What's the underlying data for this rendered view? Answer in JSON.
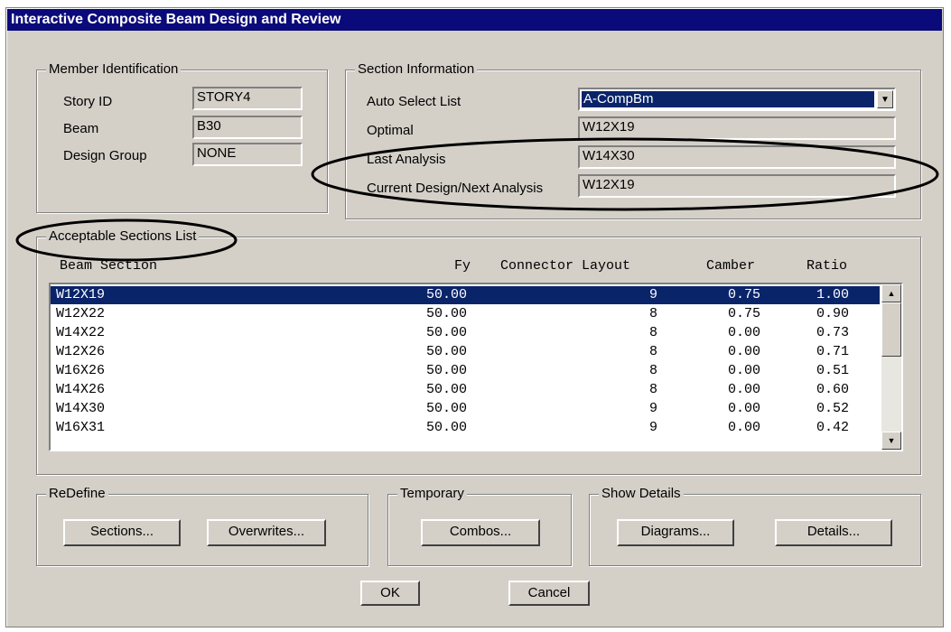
{
  "window": {
    "title": "Interactive Composite Beam Design and Review"
  },
  "member_identification": {
    "title": "Member Identification",
    "story_label": "Story ID",
    "story_value": "STORY4",
    "beam_label": "Beam",
    "beam_value": "B30",
    "group_label": "Design Group",
    "group_value": "NONE"
  },
  "section_information": {
    "title": "Section Information",
    "auto_select_label": "Auto Select List",
    "auto_select_value": "A-CompBm",
    "optimal_label": "Optimal",
    "optimal_value": "W12X19",
    "last_analysis_label": "Last Analysis",
    "last_analysis_value": "W14X30",
    "current_label": "Current Design/Next Analysis",
    "current_value": "W12X19"
  },
  "acceptable_sections": {
    "title": "Acceptable Sections List",
    "columns": [
      "Beam Section",
      "Fy",
      "Connector Layout",
      "Camber",
      "Ratio"
    ],
    "rows": [
      {
        "section": "W12X19",
        "fy": "50.00",
        "layout": "9",
        "camber": "0.75",
        "ratio": "1.00",
        "selected": true
      },
      {
        "section": "W12X22",
        "fy": "50.00",
        "layout": "8",
        "camber": "0.75",
        "ratio": "0.90"
      },
      {
        "section": "W14X22",
        "fy": "50.00",
        "layout": "8",
        "camber": "0.00",
        "ratio": "0.73"
      },
      {
        "section": "W12X26",
        "fy": "50.00",
        "layout": "8",
        "camber": "0.00",
        "ratio": "0.71"
      },
      {
        "section": "W16X26",
        "fy": "50.00",
        "layout": "8",
        "camber": "0.00",
        "ratio": "0.51"
      },
      {
        "section": "W14X26",
        "fy": "50.00",
        "layout": "8",
        "camber": "0.00",
        "ratio": "0.60"
      },
      {
        "section": "W14X30",
        "fy": "50.00",
        "layout": "9",
        "camber": "0.00",
        "ratio": "0.52"
      },
      {
        "section": "W16X31",
        "fy": "50.00",
        "layout": "9",
        "camber": "0.00",
        "ratio": "0.42"
      }
    ]
  },
  "redefine": {
    "title": "ReDefine",
    "sections_button": "Sections...",
    "overwrites_button": "Overwrites..."
  },
  "temporary": {
    "title": "Temporary",
    "combos_button": "Combos..."
  },
  "show_details": {
    "title": "Show Details",
    "diagrams_button": "Diagrams...",
    "details_button": "Details..."
  },
  "footer": {
    "ok_button": "OK",
    "cancel_button": "Cancel"
  }
}
